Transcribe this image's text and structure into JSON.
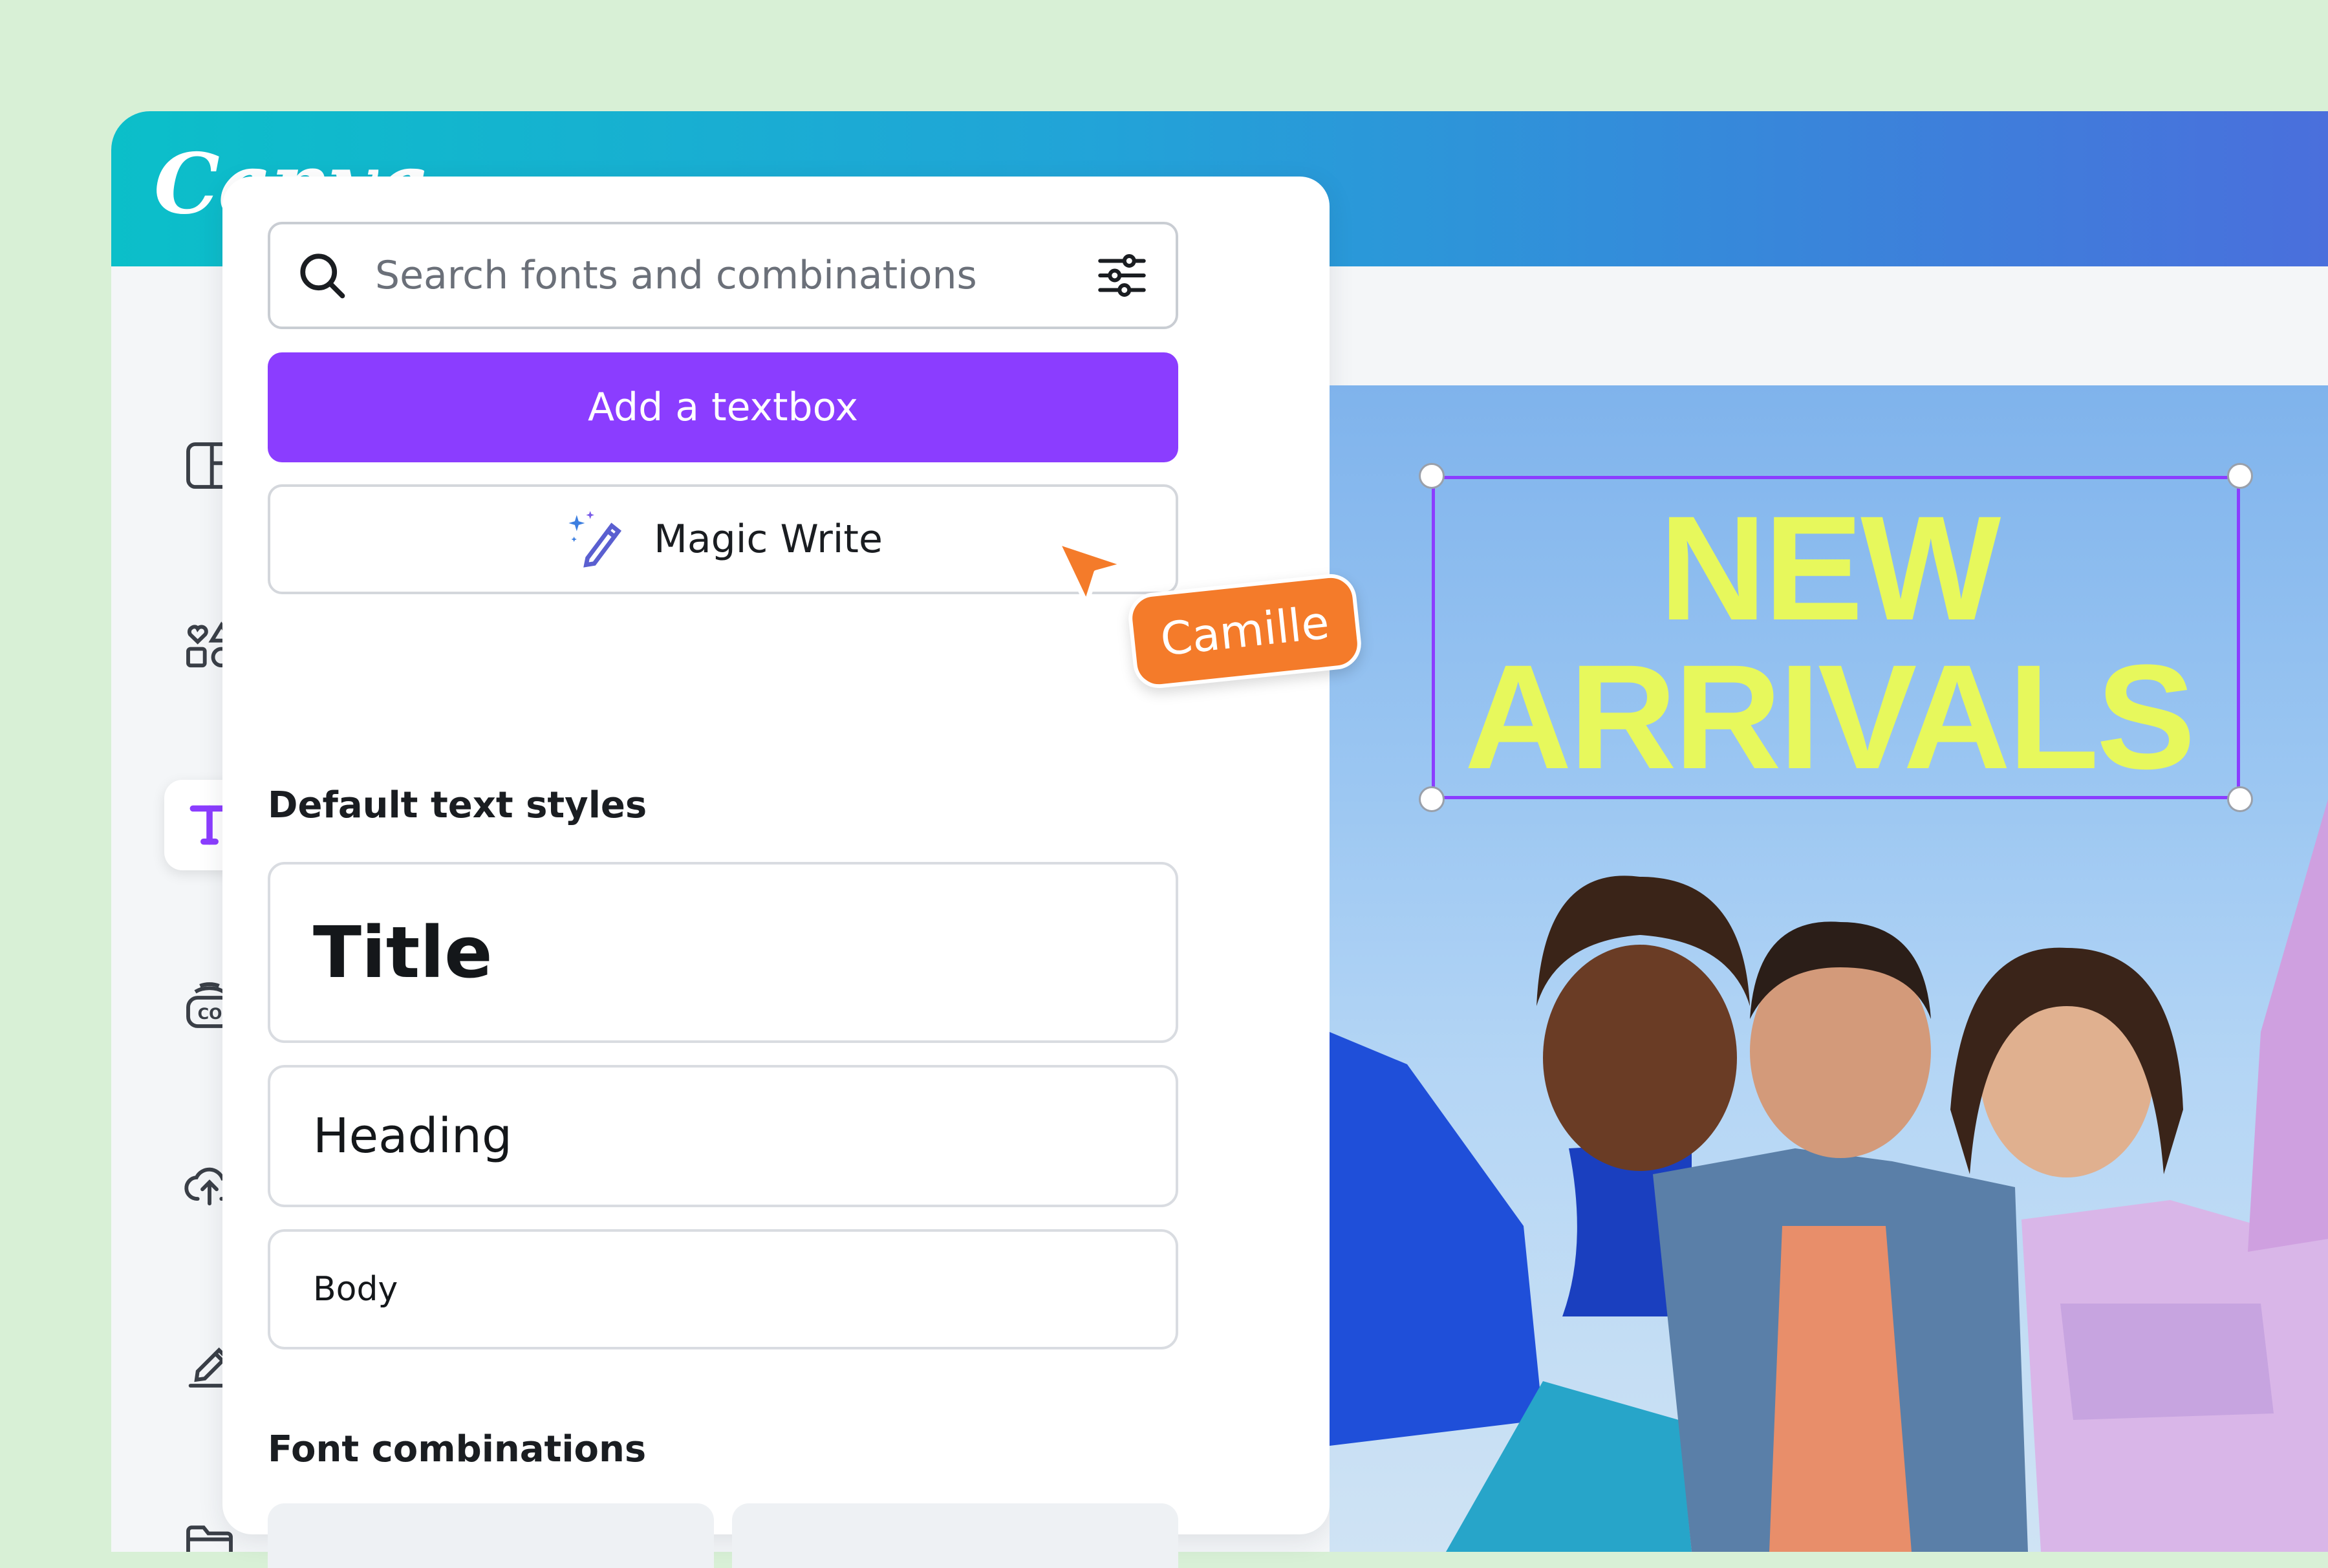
{
  "app": {
    "logo": "Canva"
  },
  "rail": {
    "items": [
      "design-icon",
      "elements-icon",
      "text-icon",
      "brand-icon",
      "uploads-icon",
      "draw-icon",
      "projects-icon"
    ],
    "active": "text-icon"
  },
  "panel": {
    "search_placeholder": "Search fonts and combinations",
    "add_textbox_label": "Add a textbox",
    "magic_write_label": "Magic Write",
    "default_styles_heading": "Default text styles",
    "styles": {
      "title": "Title",
      "heading": "Heading",
      "body": "Body"
    },
    "font_combinations_heading": "Font combinations"
  },
  "canvas": {
    "headline_line1": "NEW",
    "headline_line2": "ARRIVALS"
  },
  "collaborator": {
    "name": "Camille"
  },
  "colors": {
    "accent": "#8b3dff",
    "tag": "#f47b2a",
    "headline": "#e7f85c"
  }
}
